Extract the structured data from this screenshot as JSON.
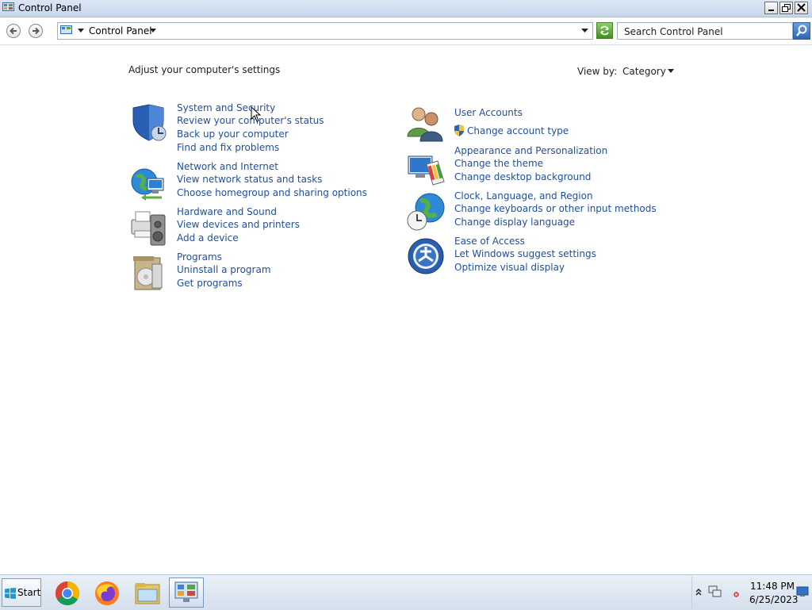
{
  "window": {
    "title": "Control Panel"
  },
  "address_bar": {
    "breadcrumb": "Control Panel",
    "search_placeholder": "Search Control Panel"
  },
  "main": {
    "heading": "Adjust your computer's settings",
    "view_by_label": "View by:",
    "view_by_value": "Category",
    "categories": [
      {
        "title": "System and Security",
        "icon": "shield-icon",
        "links": [
          "Review your computer's status",
          "Back up your computer",
          "Find and fix problems"
        ]
      },
      {
        "title": "Network and Internet",
        "icon": "network-globe-icon",
        "links": [
          "View network status and tasks",
          "Choose homegroup and sharing options"
        ]
      },
      {
        "title": "Hardware and Sound",
        "icon": "printer-speaker-icon",
        "links": [
          "View devices and printers",
          "Add a device"
        ]
      },
      {
        "title": "Programs",
        "icon": "programs-box-icon",
        "links": [
          "Uninstall a program",
          "Get programs"
        ]
      },
      {
        "title": "User Accounts",
        "icon": "users-icon",
        "links": [
          "Change account type"
        ]
      },
      {
        "title": "Appearance and Personalization",
        "icon": "monitor-paint-icon",
        "links": [
          "Change the theme",
          "Change desktop background"
        ]
      },
      {
        "title": "Clock, Language, and Region",
        "icon": "globe-clock-icon",
        "links": [
          "Change keyboards or other input methods",
          "Change display language"
        ]
      },
      {
        "title": "Ease of Access",
        "icon": "ease-of-access-icon",
        "links": [
          "Let Windows suggest settings",
          "Optimize visual display"
        ]
      }
    ]
  },
  "taskbar": {
    "start_label": "Start",
    "apps": [
      "chrome-icon",
      "firefox-icon",
      "file-explorer-icon",
      "control-panel-icon"
    ],
    "clock_time": "11:48 PM",
    "clock_date": "6/25/2023"
  }
}
